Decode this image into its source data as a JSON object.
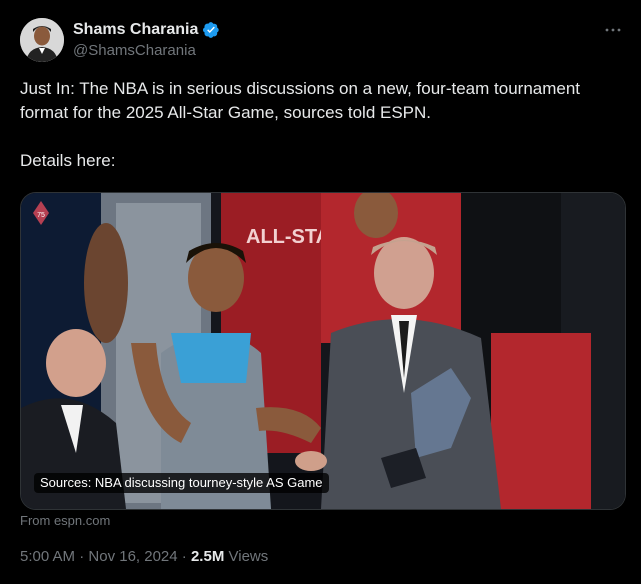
{
  "author": {
    "display_name": "Shams Charania",
    "handle": "@ShamsCharania",
    "verified_icon": "verified-badge-icon"
  },
  "more_icon": "more-horizontal-icon",
  "tweet": {
    "text": "Just In: The NBA is in serious discussions on a new, four-team tournament format for the 2025 All-Star Game, sources told ESPN.\n\nDetails here:"
  },
  "card": {
    "caption": "Sources: NBA discussing tourney-style AS Game",
    "source": "From espn.com",
    "jersey_text": "ALL-STA"
  },
  "meta": {
    "time": "5:00 AM",
    "separator": "·",
    "date": "Nov 16, 2024",
    "views_count": "2.5M",
    "views_label": "Views"
  },
  "colors": {
    "verified": "#1d9bf0",
    "background": "#000000",
    "secondary_text": "#71767b",
    "primary_text": "#e7e9ea"
  }
}
